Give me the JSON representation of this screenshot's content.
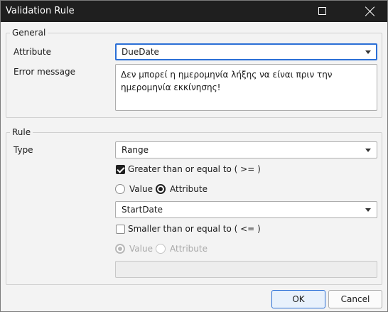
{
  "window": {
    "title": "Validation Rule",
    "maximize_icon": "maximize-icon",
    "close_icon": "close-icon"
  },
  "general": {
    "legend": "General",
    "attribute_label": "Attribute",
    "attribute_value": "DueDate",
    "error_label": "Error message",
    "error_value": "Δεν μπορεί η ημερομηνία λήξης να είναι πριν την ημερομηνία εκκίνησης!"
  },
  "rule": {
    "legend": "Rule",
    "type_label": "Type",
    "type_value": "Range",
    "greater": {
      "label": "Greater than or equal to ( >= )",
      "checked": true,
      "value_option": "Value",
      "attribute_option": "Attribute",
      "selected": "Attribute",
      "attribute_value": "StartDate"
    },
    "smaller": {
      "label": "Smaller than or equal to  ( <= )",
      "checked": false,
      "value_option": "Value",
      "attribute_option": "Attribute",
      "selected": "Value",
      "value": ""
    }
  },
  "buttons": {
    "ok": "OK",
    "cancel": "Cancel"
  },
  "colors": {
    "titlebar": "#1f1f1f",
    "accent": "#2b6fd6",
    "background": "#f3f3f3"
  }
}
